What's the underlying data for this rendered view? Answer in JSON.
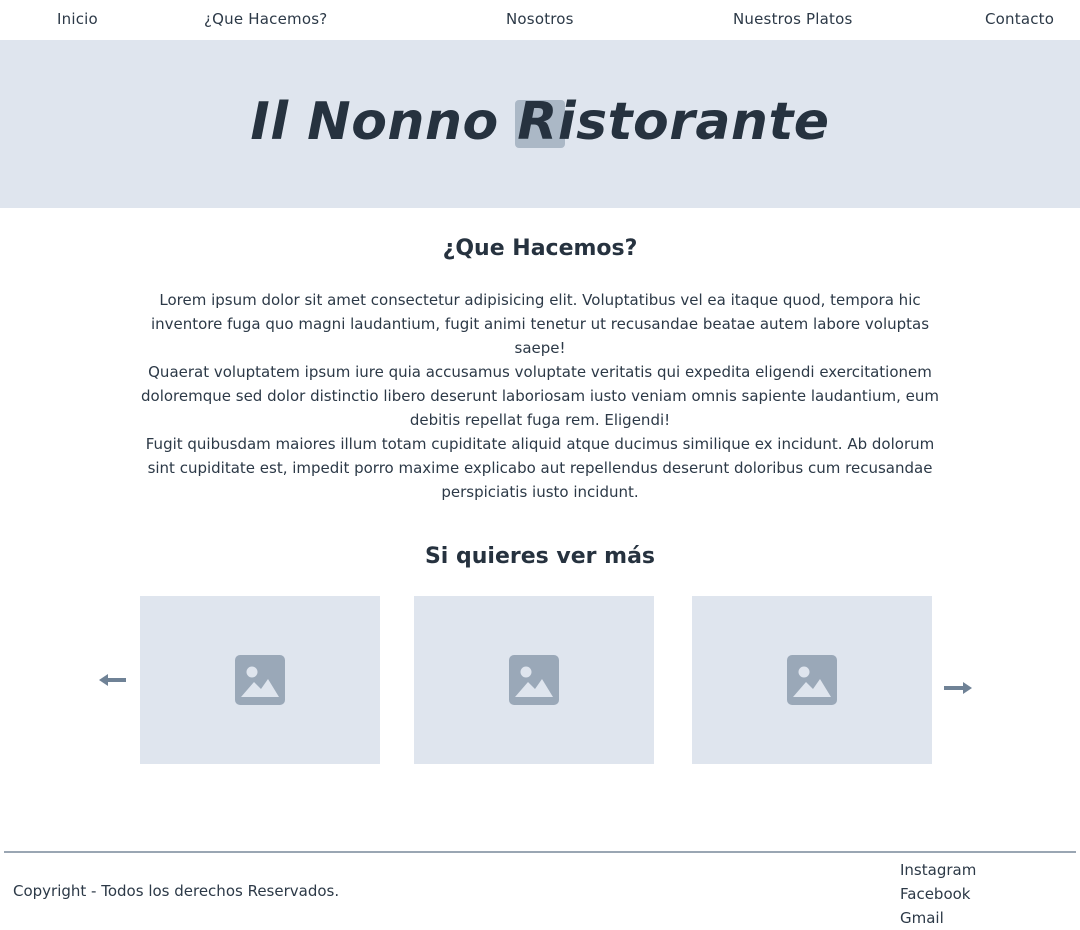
{
  "nav": {
    "items": [
      {
        "label": "Inicio"
      },
      {
        "label": "¿Que Hacemos?"
      },
      {
        "label": "Nosotros"
      },
      {
        "label": "Nuestros Platos"
      },
      {
        "label": "Contacto"
      }
    ]
  },
  "hero": {
    "title": "Il Nonno Ristorante"
  },
  "about": {
    "title": "¿Que Hacemos?",
    "paragraphs": [
      "Lorem ipsum dolor sit amet consectetur adipisicing elit. Voluptatibus vel ea itaque quod, tempora hic inventore fuga quo magni laudantium, fugit animi tenetur ut recusandae beatae autem labore voluptas saepe!",
      "Quaerat voluptatem ipsum iure quia accusamus voluptate veritatis qui expedita eligendi exercitationem doloremque sed dolor distinctio libero deserunt laboriosam iusto veniam omnis sapiente laudantium, eum debitis repellat fuga rem. Eligendi!",
      "Fugit quibusdam maiores illum totam cupiditate aliquid atque ducimus similique ex incidunt. Ab dolorum sint cupiditate est, impedit porro maxime explicabo aut repellendus deserunt doloribus cum recusandae perspiciatis iusto incidunt."
    ]
  },
  "gallery": {
    "title": "Si quieres ver más",
    "cards": [
      {
        "icon": "image-placeholder-icon"
      },
      {
        "icon": "image-placeholder-icon"
      },
      {
        "icon": "image-placeholder-icon"
      }
    ],
    "prev_icon": "arrow-left-icon",
    "next_icon": "arrow-right-icon"
  },
  "footer": {
    "copyright": "Copyright - Todos los derechos Reservados.",
    "social": [
      {
        "label": "Instagram"
      },
      {
        "label": "Facebook"
      },
      {
        "label": "Gmail"
      }
    ]
  },
  "colors": {
    "accent_bg": "#dfe5ee",
    "text": "#26323f",
    "icon": "#9aa8b8",
    "arrow": "#6f8296"
  }
}
